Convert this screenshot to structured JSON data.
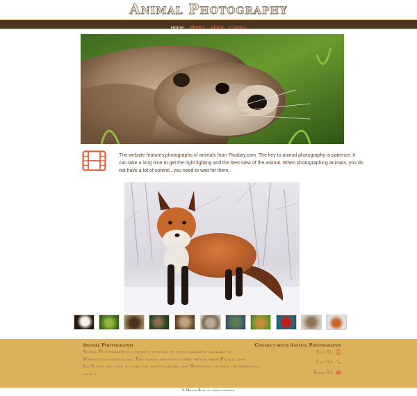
{
  "header": {
    "site_title": "Animal Photography"
  },
  "nav": {
    "items": [
      {
        "label": "Home",
        "active": true
      },
      {
        "label": "Photos",
        "active": false
      },
      {
        "label": "About",
        "active": false
      },
      {
        "label": "Contact",
        "active": false
      }
    ]
  },
  "hero": {
    "image": "otter-photo"
  },
  "intro": {
    "icon": "film-icon",
    "text": "The website features photographs of animals from Pixabay.com. The key to animal photography is patience. It can take a long time to get the right lighting and the best view of the animal. When photographing animals, you do not have a lot of control...you need to wait for them."
  },
  "gallery": {
    "main_image": "red-fox-in-snow-photo",
    "thumbnails": [
      "eagle",
      "frog",
      "bison",
      "deer",
      "owl",
      "hedgehog",
      "turtle",
      "lizard",
      "ladybug",
      "goat",
      "fox"
    ]
  },
  "footer": {
    "title": "Animal Photography",
    "description": "Animal Photography is a website exercise on image galleries available on Webdevfoundations.com. The images are royalty-free photos from Pixabay.com. JavaScript was used to make the photo gallery, and Bootstrap columns for responsive layout.",
    "connect_title": "Connect with Animal Photography",
    "contacts": [
      {
        "label": "Text Us",
        "icon": "mobile-icon"
      },
      {
        "label": "Call Us",
        "icon": "phone-icon"
      },
      {
        "label": "Email Us",
        "icon": "envelope-icon"
      }
    ],
    "copyright": "© Melissa Ross, all rights reserved."
  },
  "colors": {
    "nav_background": "#4a3521",
    "nav_link": "#e07a4a",
    "footer_background": "#dbb25a",
    "icon_accent": "#e0603b"
  }
}
